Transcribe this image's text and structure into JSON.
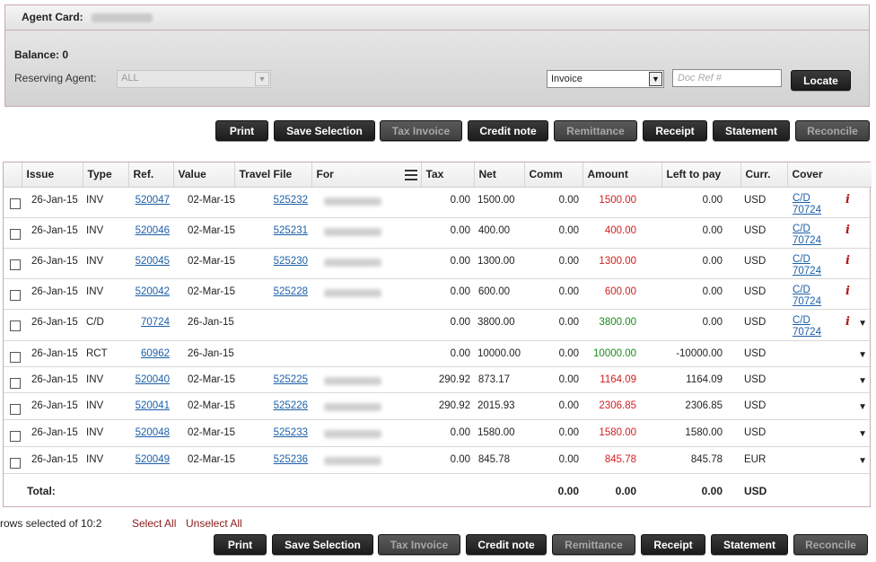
{
  "agent": {
    "card_label": "Agent Card:",
    "balance_label": "Balance: 0",
    "reserving_agent_label": "Reserving Agent:",
    "reserving_agent_value": "ALL",
    "doc_type_value": "Invoice",
    "doc_ref_placeholder": "Doc Ref #",
    "locate_label": "Locate"
  },
  "toolbar": {
    "print": "Print",
    "save_selection": "Save Selection",
    "tax_invoice": "Tax Invoice",
    "credit_note": "Credit note",
    "remittance": "Remittance",
    "receipt": "Receipt",
    "statement": "Statement",
    "reconcile": "Reconcile"
  },
  "columns": [
    "Issue",
    "Type",
    "Ref.",
    "Value",
    "Travel File",
    "For",
    "Tax",
    "Net",
    "Comm",
    "Amount",
    "Left to pay",
    "Curr.",
    "Cover"
  ],
  "rows": [
    {
      "issue": "26-Jan-15",
      "type": "INV",
      "ref": "520047",
      "value": "02-Mar-15",
      "travel_file": "525232",
      "tax": "0.00",
      "net": "1500.00",
      "comm": "0.00",
      "amount": "1500.00",
      "left": "0.00",
      "curr": "USD",
      "cover1": "C/D",
      "cover2": "70724",
      "info": "i",
      "dropdown": ""
    },
    {
      "issue": "26-Jan-15",
      "type": "INV",
      "ref": "520046",
      "value": "02-Mar-15",
      "travel_file": "525231",
      "tax": "0.00",
      "net": "400.00",
      "comm": "0.00",
      "amount": "400.00",
      "left": "0.00",
      "curr": "USD",
      "cover1": "C/D",
      "cover2": "70724",
      "info": "i",
      "dropdown": ""
    },
    {
      "issue": "26-Jan-15",
      "type": "INV",
      "ref": "520045",
      "value": "02-Mar-15",
      "travel_file": "525230",
      "tax": "0.00",
      "net": "1300.00",
      "comm": "0.00",
      "amount": "1300.00",
      "left": "0.00",
      "curr": "USD",
      "cover1": "C/D",
      "cover2": "70724",
      "info": "i",
      "dropdown": ""
    },
    {
      "issue": "26-Jan-15",
      "type": "INV",
      "ref": "520042",
      "value": "02-Mar-15",
      "travel_file": "525228",
      "tax": "0.00",
      "net": "600.00",
      "comm": "0.00",
      "amount": "600.00",
      "left": "0.00",
      "curr": "USD",
      "cover1": "C/D",
      "cover2": "70724",
      "info": "i",
      "dropdown": ""
    },
    {
      "issue": "26-Jan-15",
      "type": "C/D",
      "ref": "70724",
      "value": "26-Jan-15",
      "travel_file": "",
      "tax": "0.00",
      "net": "3800.00",
      "comm": "0.00",
      "amount": "3800.00",
      "left": "0.00",
      "curr": "USD",
      "cover1": "C/D",
      "cover2": "70724",
      "info": "i",
      "dropdown": "▼"
    },
    {
      "issue": "26-Jan-15",
      "type": "RCT",
      "ref": "60962",
      "value": "26-Jan-15",
      "travel_file": "",
      "tax": "0.00",
      "net": "10000.00",
      "comm": "0.00",
      "amount": "10000.00",
      "left": "-10000.00",
      "curr": "USD",
      "cover1": "",
      "cover2": "",
      "info": "",
      "dropdown": "▼"
    },
    {
      "issue": "26-Jan-15",
      "type": "INV",
      "ref": "520040",
      "value": "02-Mar-15",
      "travel_file": "525225",
      "tax": "290.92",
      "net": "873.17",
      "comm": "0.00",
      "amount": "1164.09",
      "left": "1164.09",
      "curr": "USD",
      "cover1": "",
      "cover2": "",
      "info": "",
      "dropdown": "▼"
    },
    {
      "issue": "26-Jan-15",
      "type": "INV",
      "ref": "520041",
      "value": "02-Mar-15",
      "travel_file": "525226",
      "tax": "290.92",
      "net": "2015.93",
      "comm": "0.00",
      "amount": "2306.85",
      "left": "2306.85",
      "curr": "USD",
      "cover1": "",
      "cover2": "",
      "info": "",
      "dropdown": "▼"
    },
    {
      "issue": "26-Jan-15",
      "type": "INV",
      "ref": "520048",
      "value": "02-Mar-15",
      "travel_file": "525233",
      "tax": "0.00",
      "net": "1580.00",
      "comm": "0.00",
      "amount": "1580.00",
      "left": "1580.00",
      "curr": "USD",
      "cover1": "",
      "cover2": "",
      "info": "",
      "dropdown": "▼"
    },
    {
      "issue": "26-Jan-15",
      "type": "INV",
      "ref": "520049",
      "value": "02-Mar-15",
      "travel_file": "525236",
      "tax": "0.00",
      "net": "845.78",
      "comm": "0.00",
      "amount": "845.78",
      "left": "845.78",
      "curr": "EUR",
      "cover1": "",
      "cover2": "",
      "info": "",
      "dropdown": "▼"
    }
  ],
  "totals": {
    "label": "Total:",
    "comm": "0.00",
    "amount": "0.00",
    "left": "0.00",
    "curr": "USD"
  },
  "footer": {
    "rows_selected": "rows selected of 10:2",
    "select_all": "Select All",
    "unselect_all": "Unselect All"
  },
  "colors": {
    "amount_red": "#d02020",
    "amount_green": "#1a8a1a",
    "link_blue": "#1b5fa8"
  }
}
